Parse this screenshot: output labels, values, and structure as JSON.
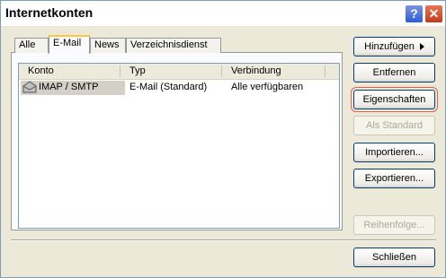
{
  "window": {
    "title": "Internetkonten"
  },
  "tabs": [
    {
      "label": "Alle"
    },
    {
      "label": "E-Mail"
    },
    {
      "label": "News"
    },
    {
      "label": "Verzeichnisdienst"
    }
  ],
  "list": {
    "columns": [
      "Konto",
      "Typ",
      "Verbindung"
    ],
    "rows": [
      {
        "konto": "IMAP / SMTP",
        "typ": "E-Mail (Standard)",
        "verbindung": "Alle verfügbaren"
      }
    ]
  },
  "buttons": {
    "add": "Hinzufügen",
    "remove": "Entfernen",
    "properties": "Eigenschaften",
    "default": "Als Standard",
    "import": "Importieren...",
    "export": "Exportieren...",
    "order": "Reihenfolge...",
    "close": "Schließen"
  },
  "titlebar": {
    "help": "?",
    "close": "✕"
  }
}
